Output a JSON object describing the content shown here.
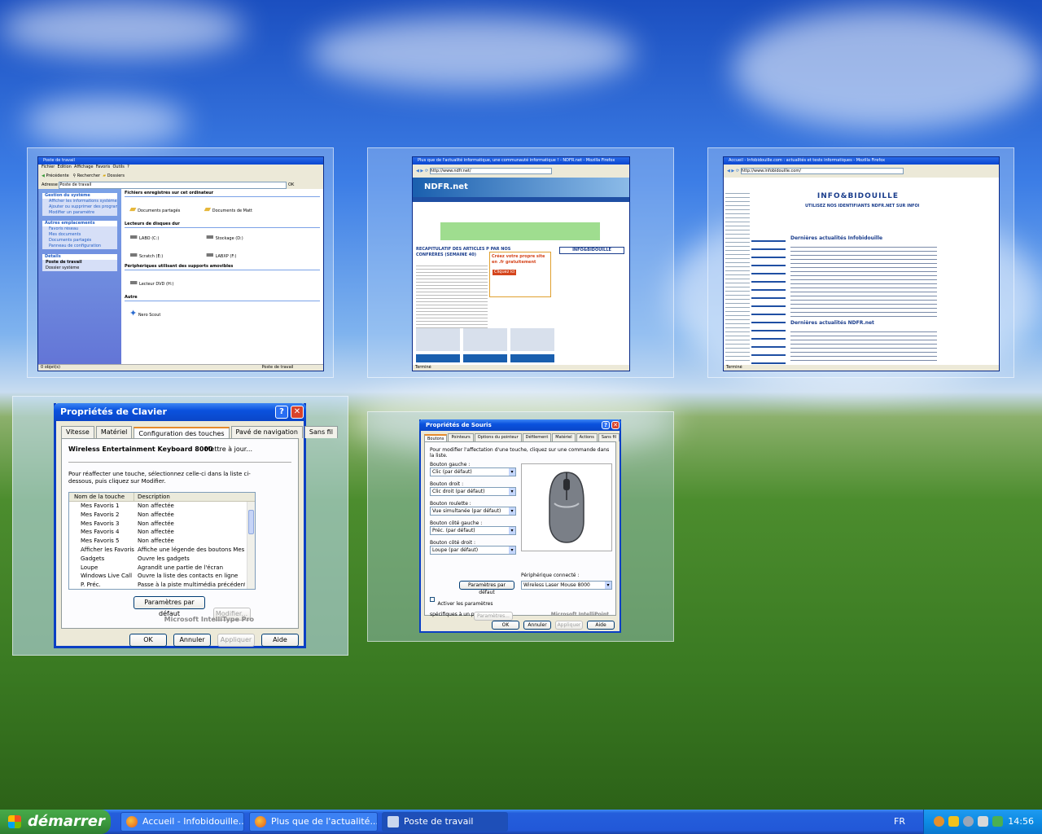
{
  "taskbar": {
    "start_label": "démarrer",
    "tasks": [
      {
        "label": "Accueil - Infobidouille..."
      },
      {
        "label": "Plus que de l'actualité..."
      },
      {
        "label": "Poste de travail"
      }
    ],
    "language": "FR",
    "clock": "14:56"
  },
  "explorer_thumb": {
    "title": "Poste de travail",
    "menu": [
      "Fichier",
      "Edition",
      "Affichage",
      "Favoris",
      "Outils",
      "?"
    ],
    "toolbar": {
      "back": "Précédente",
      "search": "Rechercher",
      "folders": "Dossiers"
    },
    "address_label": "Adresse",
    "address_value": "Poste de travail",
    "go_label": "OK",
    "side_tasks": {
      "title": "Gestion du système",
      "items": [
        "Afficher les informations système",
        "Ajouter ou supprimer des programmes",
        "Modifier un paramètre"
      ]
    },
    "side_places": {
      "title": "Autres emplacements",
      "items": [
        "Favoris réseau",
        "Mes documents",
        "Documents partagés",
        "Panneau de configuration"
      ]
    },
    "side_details": {
      "title": "Détails",
      "name": "Poste de travail",
      "type": "Dossier système"
    },
    "sections": [
      {
        "title": "Fichiers enregistrés sur cet ordinateur",
        "items": [
          "Documents partagés",
          "Documents de Matt"
        ]
      },
      {
        "title": "Lecteurs de disques dur",
        "items": [
          "LABO (C:)",
          "Stockage (D:)",
          "Scratch (E:)",
          "LABXP (F:)"
        ]
      },
      {
        "title": "Périphériques utilisant des supports amovibles",
        "items": [
          "Lecteur DVD (H:)"
        ]
      },
      {
        "title": "Autre",
        "items": [
          "Nero Scout"
        ]
      }
    ],
    "status_left": "0 objet(s)",
    "status_right": "Poste de travail"
  },
  "ndfr_thumb": {
    "title": "Plus que de l'actualité informatique, une communauté informatique ! - NDFR.net - Mozilla Firefox",
    "url": "http://www.ndfr.net/",
    "logo": "NDFR.net",
    "headline": "RÉCAPITULATIF DES ARTICLES P PAR NOS CONFRÈRES (SEMAINE 40)",
    "ad_text": "Créez votre propre site en .fr gratuitement",
    "ad_button": "Cliquez ici",
    "brand": "INFO&BIDOUILLE",
    "status": "Terminé"
  },
  "infobidouille_thumb": {
    "title": "Accueil - Infobidouille.com : actualités et tests informatiques - Mozilla Firefox",
    "url": "http://www.infobidouille.com/",
    "brand": "INFO&BIDOUILLE",
    "tagline": "UTILISEZ NOS IDENTIFIANTS NDFR.NET SUR INFOBIDOUILLE !",
    "section1": "Dernières actualités Infobidouille",
    "section2": "Dernières actualités NDFR.net",
    "status": "Terminé"
  },
  "keyboard_dialog": {
    "title": "Propriétés de Clavier",
    "tabs": [
      "Vitesse",
      "Matériel",
      "Configuration des touches",
      "Pavé de navigation",
      "Sans fil"
    ],
    "device": "Wireless Entertainment Keyboard 8000",
    "update_link": "Mettre à jour...",
    "instructions": "Pour réaffecter une touche, sélectionnez celle-ci dans la liste ci-dessous, puis cliquez sur Modifier.",
    "col_key": "Nom de la touche",
    "col_desc": "Description",
    "rows": [
      {
        "key": "Mes Favoris 1",
        "desc": "Non affectée"
      },
      {
        "key": "Mes Favoris 2",
        "desc": "Non affectée"
      },
      {
        "key": "Mes Favoris 3",
        "desc": "Non affectée"
      },
      {
        "key": "Mes Favoris 4",
        "desc": "Non affectée"
      },
      {
        "key": "Mes Favoris 5",
        "desc": "Non affectée"
      },
      {
        "key": "Afficher les Favoris",
        "desc": "Affiche une légende des boutons Mes ..."
      },
      {
        "key": "Gadgets",
        "desc": "Ouvre les gadgets"
      },
      {
        "key": "Loupe",
        "desc": "Agrandit une partie de l'écran"
      },
      {
        "key": "Windows Live Call",
        "desc": "Ouvre la liste des contacts en ligne"
      },
      {
        "key": "P. Préc.",
        "desc": "Passe à la piste multimédia précédente"
      }
    ],
    "defaults_button": "Paramètres par défaut",
    "modify_button": "Modifier...",
    "brand": "Microsoft IntelliType Pro",
    "ok": "OK",
    "cancel": "Annuler",
    "apply": "Appliquer",
    "help": "Aide"
  },
  "mouse_dialog": {
    "title": "Propriétés de Souris",
    "tabs": [
      "Boutons",
      "Pointeurs",
      "Options du pointeur",
      "Défilement",
      "Matériel",
      "Actions",
      "Sans fil"
    ],
    "instructions": "Pour modifier l'affectation d'une touche, cliquez sur une commande dans la liste.",
    "fields": [
      {
        "label": "Bouton gauche :",
        "value": "Clic (par défaut)"
      },
      {
        "label": "Bouton droit :",
        "value": "Clic droit (par défaut)"
      },
      {
        "label": "Bouton roulette :",
        "value": "Vue simultanée (par défaut)"
      },
      {
        "label": "Bouton côté gauche :",
        "value": "Préc. (par défaut)"
      },
      {
        "label": "Bouton côté droit :",
        "value": "Loupe (par défaut)"
      }
    ],
    "defaults_button": "Paramètres par défaut",
    "device_label": "Périphérique connecté :",
    "device_value": "Wireless Laser Mouse 8000",
    "app_specific": "Activer les paramètres spécifiques à un programme",
    "settings_button": "Paramètres...",
    "brand": "Microsoft IntelliPoint",
    "ok": "OK",
    "cancel": "Annuler",
    "apply": "Appliquer",
    "help": "Aide"
  }
}
